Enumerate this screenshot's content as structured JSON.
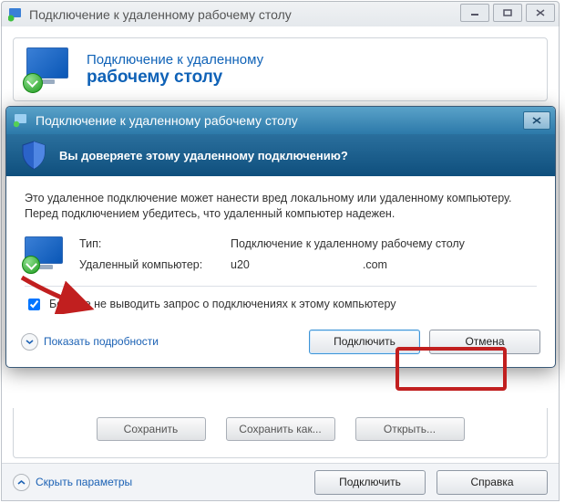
{
  "back_window": {
    "title": "Подключение к удаленному рабочему столу",
    "header_line1": "Подключение к удаленному",
    "header_line2": "рабочему столу",
    "buttons": {
      "save": "Сохранить",
      "save_as": "Сохранить как...",
      "open": "Открыть..."
    },
    "footer": {
      "hide_params": "Скрыть параметры",
      "connect": "Подключить",
      "help": "Справка"
    }
  },
  "modal": {
    "title": "Подключение к удаленному рабочему столу",
    "banner": "Вы доверяете этому удаленному подключению?",
    "body_text": "Это удаленное подключение может нанести вред локальному или удаленному компьютеру. Перед подключением убедитесь, что удаленный компьютер надежен.",
    "details": {
      "type_label": "Тип:",
      "type_value": "Подключение к удаленному рабочему столу",
      "host_label": "Удаленный компьютер:",
      "host_prefix": "u20",
      "host_suffix": ".com"
    },
    "checkbox_label": "Больше не выводить запрос о подключениях к этому компьютеру",
    "checkbox_checked": true,
    "show_details": "Показать подробности",
    "connect": "Подключить",
    "cancel": "Отмена"
  }
}
